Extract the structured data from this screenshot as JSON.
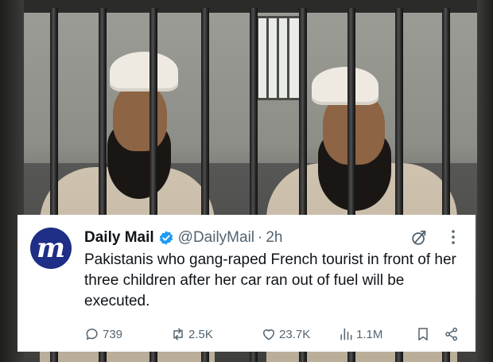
{
  "tweet": {
    "avatar_letter": "m",
    "display_name": "Daily Mail",
    "handle": "@DailyMail",
    "separator": "·",
    "time": "2h",
    "text": "Pakistanis who gang-raped French tourist in front of her three children after her car ran out of fuel will be executed.",
    "more_label": "···",
    "actions": {
      "replies": "739",
      "reposts": "2.5K",
      "likes": "23.7K",
      "views": "1.1M"
    }
  },
  "colors": {
    "avatar_bg": "#1f2e86",
    "verified": "#1d9bf0",
    "text": "#0f1419",
    "muted": "#536471"
  },
  "icons": [
    "verified-badge-icon",
    "grok-icon",
    "more-icon",
    "reply-icon",
    "repost-icon",
    "like-icon",
    "views-icon",
    "bookmark-icon",
    "share-icon"
  ]
}
